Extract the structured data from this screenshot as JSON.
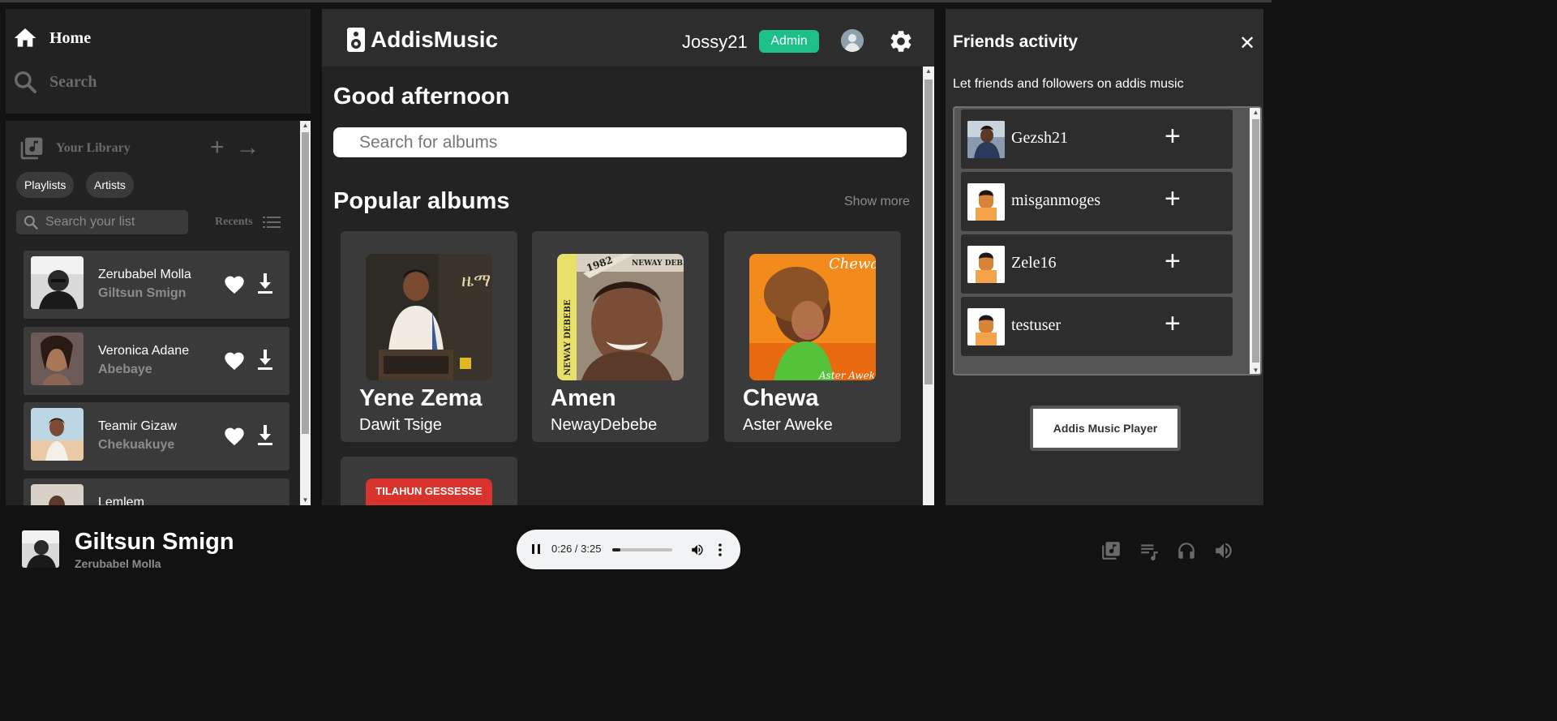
{
  "nav": {
    "home": "Home",
    "search": "Search"
  },
  "library": {
    "title": "Your Library",
    "chips": [
      "Playlists",
      "Artists"
    ],
    "search_placeholder": "Search your list",
    "recents": "Recents",
    "songs": [
      {
        "artist": "Zerubabel Molla",
        "title": "Giltsun Smign"
      },
      {
        "artist": "Veronica Adane",
        "title": "Abebaye"
      },
      {
        "artist": "Teamir Gizaw",
        "title": "Chekuakuye"
      },
      {
        "artist": "Lemlem",
        "title": ""
      }
    ]
  },
  "header": {
    "brand": "AddisMusic",
    "username": "Jossy21",
    "role_badge": "Admin",
    "accent_color": "#1ec08a"
  },
  "main": {
    "greeting": "Good afternoon",
    "search_placeholder": "Search for albums",
    "section_title": "Popular albums",
    "show_more": "Show more",
    "albums": [
      {
        "title": "Yene Zema",
        "artist": "Dawit Tsige"
      },
      {
        "title": "Amen",
        "artist": "NewayDebebe"
      },
      {
        "title": "Chewa",
        "artist": "Aster Aweke"
      }
    ],
    "partial_album_cover_text": "TILAHUN GESSESSE"
  },
  "friends": {
    "title": "Friends activity",
    "description": "Let friends and followers on addis music",
    "list": [
      {
        "name": "Gezsh21"
      },
      {
        "name": "misganmoges"
      },
      {
        "name": "Zele16"
      },
      {
        "name": "testuser"
      }
    ],
    "player_button": "Addis Music Player"
  },
  "now_playing": {
    "title": "Giltsun Smign",
    "artist": "Zerubabel Molla",
    "time": "0:26 / 3:25",
    "progress_fraction": 0.13
  },
  "icons": [
    "home-icon",
    "search-icon",
    "library-icon",
    "plus-icon",
    "arrow-right-icon",
    "list-icon",
    "heart-icon",
    "download-icon",
    "speaker-icon",
    "gear-icon",
    "close-icon",
    "pause-icon",
    "volume-icon",
    "more-vert-icon",
    "queue-icon",
    "headphones-icon"
  ]
}
